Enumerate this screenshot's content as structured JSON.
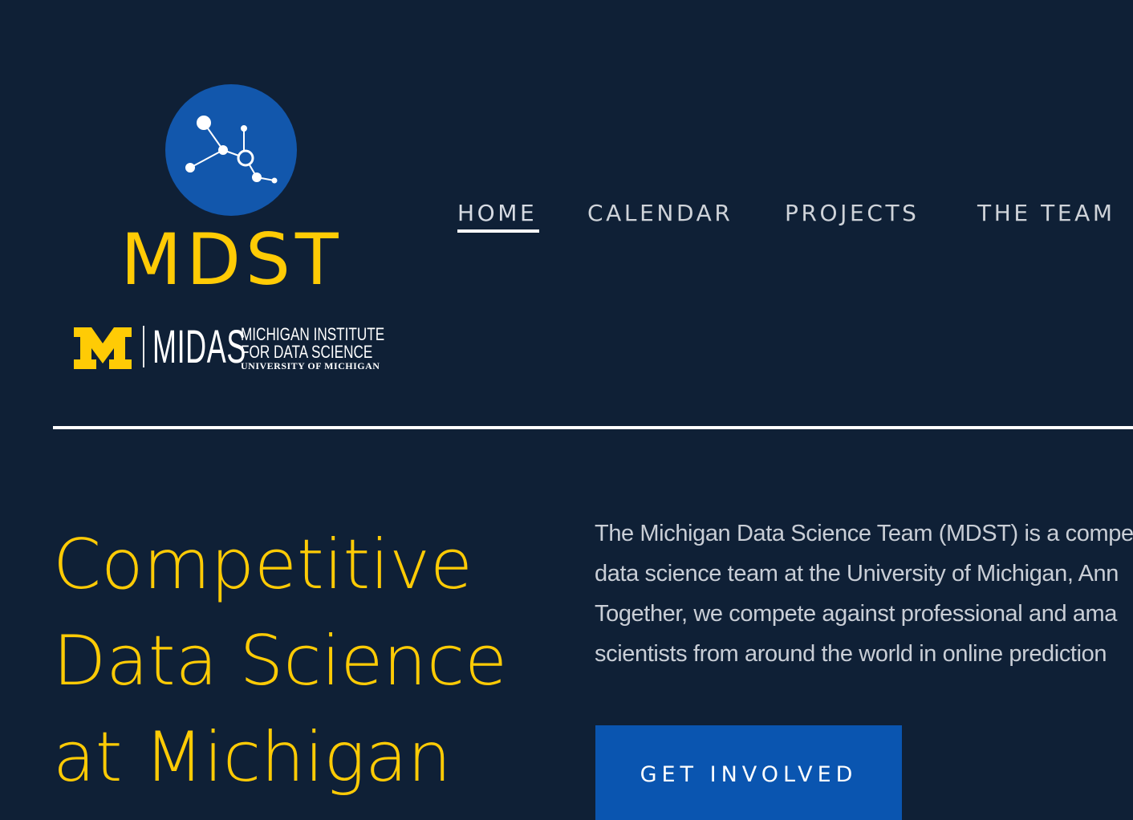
{
  "brand": {
    "logo_text": "MDST",
    "partner_name": "MIDAS",
    "partner_line1": "MICHIGAN INSTITUTE",
    "partner_line2": "FOR DATA SCIENCE",
    "partner_line3": "UNIVERSITY OF MICHIGAN",
    "colors": {
      "background": "#0f2036",
      "maize": "#ffcb05",
      "logo_blue": "#1257ac",
      "button_blue": "#0a55b0",
      "nav_text": "#cfd3d9",
      "body_text": "#c9ced6"
    }
  },
  "nav": {
    "items": [
      {
        "label": "HOME",
        "active": true
      },
      {
        "label": "CALENDAR",
        "active": false
      },
      {
        "label": "PROJECTS",
        "active": false
      },
      {
        "label": "THE TEAM",
        "active": false
      }
    ]
  },
  "hero": {
    "title_lines": [
      "Competitive",
      "Data Science",
      "at Michigan"
    ],
    "intro_lines": [
      "The Michigan Data Science Team (MDST) is a compet",
      "data science team at the University of Michigan, Ann",
      "Together, we compete against professional and ama",
      "scientists from around the world in online prediction"
    ],
    "cta_label": "GET INVOLVED"
  },
  "icons": {
    "logo_mark": "network-graph-icon",
    "block_m": "block-m-logo"
  }
}
